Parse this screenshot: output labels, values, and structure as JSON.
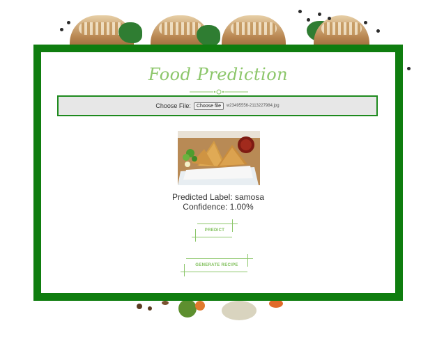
{
  "app": {
    "title": "Food Prediction"
  },
  "upload": {
    "label": "Choose File:",
    "button_label": "Choose file",
    "file_name": "w23495556-2113227984.jpg"
  },
  "image": {
    "alt": "samosa"
  },
  "prediction": {
    "label_text": "Predicted Label: samosa",
    "confidence_text": "Confidence: 1.00%"
  },
  "actions": {
    "predict_label": "PREDICT",
    "recipe_label": "GENERATE RECIPE"
  },
  "colors": {
    "frame": "#0f7d0f",
    "accent": "#8cc66a",
    "upload_bg": "#e7e7e7"
  }
}
